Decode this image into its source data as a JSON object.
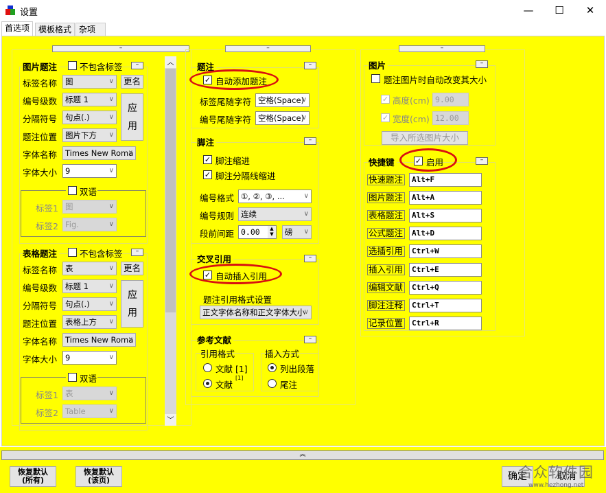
{
  "window": {
    "title": "设置",
    "minimize": "—",
    "maximize": "☐",
    "close": "✕"
  },
  "tabs": [
    "首选项",
    "模板格式",
    "杂项"
  ],
  "collapse_symbol": "–",
  "fig_caption": {
    "title": "图片题注",
    "exclude_label": "不包含标签",
    "label_name": "标签名称",
    "label_value": "图",
    "rename": "更名",
    "level": "编号级数",
    "level_value": "标题 1",
    "separator": "分隔符号",
    "separator_value": "句点(.)",
    "position": "题注位置",
    "position_value": "图片下方",
    "apply": "应用",
    "font_name": "字体名称",
    "font_value": "Times New Roma",
    "font_size": "字体大小",
    "size_value": "9",
    "bilingual": "双语",
    "label1": "标签1",
    "label1_value": "图",
    "label2": "标签2",
    "label2_value": "Fig."
  },
  "tbl_caption": {
    "title": "表格题注",
    "exclude_label": "不包含标签",
    "label_name": "标签名称",
    "label_value": "表",
    "rename": "更名",
    "level": "编号级数",
    "level_value": "标题 1",
    "separator": "分隔符号",
    "separator_value": "句点(.)",
    "position": "题注位置",
    "position_value": "表格上方",
    "apply": "应用",
    "font_name": "字体名称",
    "font_value": "Times New Roma",
    "font_size": "字体大小",
    "size_value": "9",
    "bilingual": "双语",
    "label1": "标签1",
    "label1_value": "表",
    "label2": "标签2",
    "label2_value": "Table"
  },
  "caption": {
    "title": "题注",
    "auto_add": "自动添加题注",
    "label_trail": "标签尾随字符",
    "label_trail_value": "空格(Space)",
    "num_trail": "编号尾随字符",
    "num_trail_value": "空格(Space)"
  },
  "footnote": {
    "title": "脚注",
    "indent": "脚注缩进",
    "sep_indent": "脚注分隔线缩进",
    "num_format": "编号格式",
    "num_format_value": "①, ②, ③, ...",
    "num_rule": "编号规则",
    "num_rule_value": "连续",
    "space_before": "段前间距",
    "space_value": "0.00",
    "unit": "磅"
  },
  "crossref": {
    "title": "交叉引用",
    "auto_insert": "自动插入引用",
    "format_label": "题注引用格式设置",
    "format_value": "正文字体名称和正文字体大小"
  },
  "refs": {
    "title": "参考文献",
    "cite_format": "引用格式",
    "opt1": "文献 [1]",
    "opt2": "文献",
    "opt2_sup": "[1]",
    "insert_mode": "插入方式",
    "opt3": "列出段落",
    "opt4": "尾注"
  },
  "picture": {
    "title": "图片",
    "auto_resize": "题注图片时自动改变其大小",
    "height": "高度(cm)",
    "height_value": "9.00",
    "width": "宽度(cm)",
    "width_value": "12.00",
    "import": "导入所选图片大小"
  },
  "shortcuts": {
    "title": "快捷键",
    "enable": "启用",
    "items": [
      {
        "label": "快速题注",
        "key": "Alt+F"
      },
      {
        "label": "图片题注",
        "key": "Alt+A"
      },
      {
        "label": "表格题注",
        "key": "Alt+S"
      },
      {
        "label": "公式题注",
        "key": "Alt+D"
      },
      {
        "label": "选插引用",
        "key": "Ctrl+W"
      },
      {
        "label": "插入引用",
        "key": "Ctrl+E"
      },
      {
        "label": "编辑文献",
        "key": "Ctrl+Q"
      },
      {
        "label": "脚注注释",
        "key": "Ctrl+T"
      },
      {
        "label": "记录位置",
        "key": "Ctrl+R"
      }
    ]
  },
  "footer": {
    "expand": "︽",
    "restore_all": "恢复默认\n(所有)",
    "restore_page": "恢复默认\n(该页)",
    "ok": "确定",
    "cancel": "取消"
  },
  "watermark": {
    "text": "合众软件园",
    "url": "www.hezhong.net"
  },
  "colors": {
    "background": "#ffff00",
    "highlight": "#d81010"
  }
}
